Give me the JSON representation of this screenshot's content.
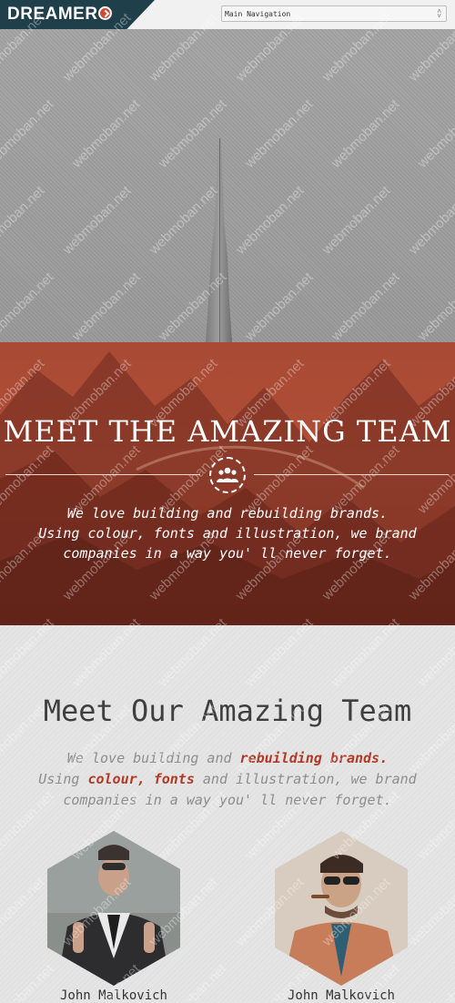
{
  "brand": {
    "logo_text": "DREAMER"
  },
  "nav": {
    "select_value": "Main Navigation"
  },
  "band": {
    "title": "MEET THE AMAZING TEAM",
    "lines": [
      "We love building and rebuilding brands.",
      "Using colour, fonts and illustration, we brand",
      "companies in a way you' ll never forget."
    ]
  },
  "team": {
    "title": "Meet Our Amazing Team",
    "intro": {
      "p1": "We love building and ",
      "p1_hl": "rebuilding brands.",
      "p2": "Using ",
      "p2_hl": "colour, fonts",
      "p2_rest": " and illustration, we brand",
      "p3": "companies in a way you' ll never forget."
    },
    "members": [
      {
        "name": "John Malkovich"
      },
      {
        "name": "John Malkovich"
      }
    ]
  },
  "watermark": {
    "text": "webmoban.net"
  },
  "colors": {
    "logo_bg": "#1f3f4a",
    "accent_red": "#b03a25",
    "band_red": "#a84a35"
  }
}
